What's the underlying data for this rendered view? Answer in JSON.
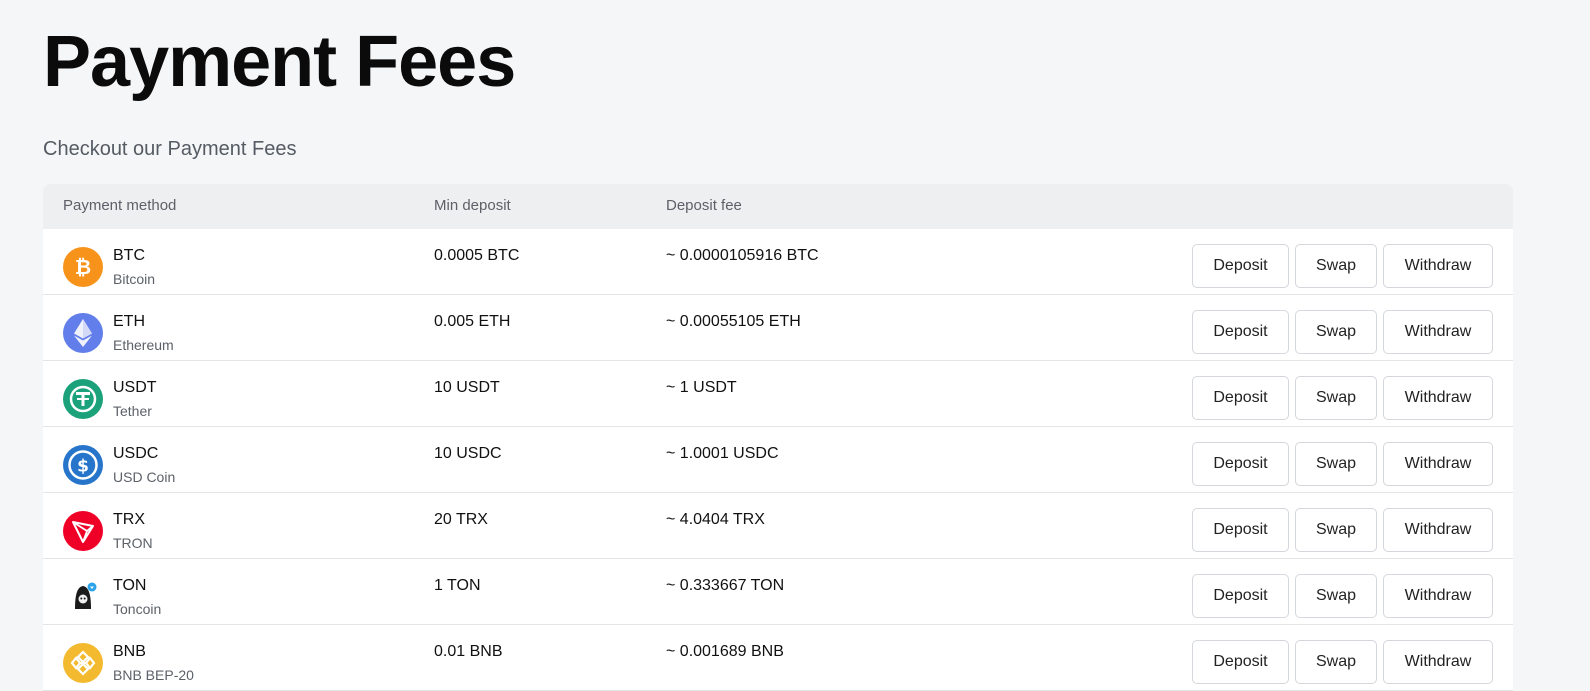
{
  "page": {
    "title": "Payment Fees",
    "subtitle": "Checkout our Payment Fees"
  },
  "table": {
    "headers": {
      "method": "Payment method",
      "min_deposit": "Min deposit",
      "deposit_fee": "Deposit fee"
    },
    "rows": [
      {
        "ticker": "BTC",
        "name": "Bitcoin",
        "min": "0.0005 BTC",
        "fee": "~ 0.0000105916 BTC",
        "icon": "bitcoin-icon",
        "color": "#f7931a"
      },
      {
        "ticker": "ETH",
        "name": "Ethereum",
        "min": "0.005 ETH",
        "fee": "~ 0.00055105 ETH",
        "icon": "ethereum-icon",
        "color": "#627eea"
      },
      {
        "ticker": "USDT",
        "name": "Tether",
        "min": "10 USDT",
        "fee": "~ 1 USDT",
        "icon": "tether-icon",
        "color": "#26a17b"
      },
      {
        "ticker": "USDC",
        "name": "USD Coin",
        "min": "10 USDC",
        "fee": "~ 1.0001 USDC",
        "icon": "usd-coin-icon",
        "color": "#2775ca"
      },
      {
        "ticker": "TRX",
        "name": "TRON",
        "min": "20 TRX",
        "fee": "~ 4.0404 TRX",
        "icon": "tron-icon",
        "color": "#ef0027"
      },
      {
        "ticker": "TON",
        "name": "Toncoin",
        "min": "1 TON",
        "fee": "~ 0.333667 TON",
        "icon": "toncoin-icon",
        "color": "#222222"
      },
      {
        "ticker": "BNB",
        "name": "BNB BEP-20",
        "min": "0.01 BNB",
        "fee": "~ 0.001689 BNB",
        "icon": "bnb-icon",
        "color": "#f3ba2f"
      }
    ],
    "buttons": {
      "deposit": "Deposit",
      "swap": "Swap",
      "withdraw": "Withdraw"
    }
  }
}
